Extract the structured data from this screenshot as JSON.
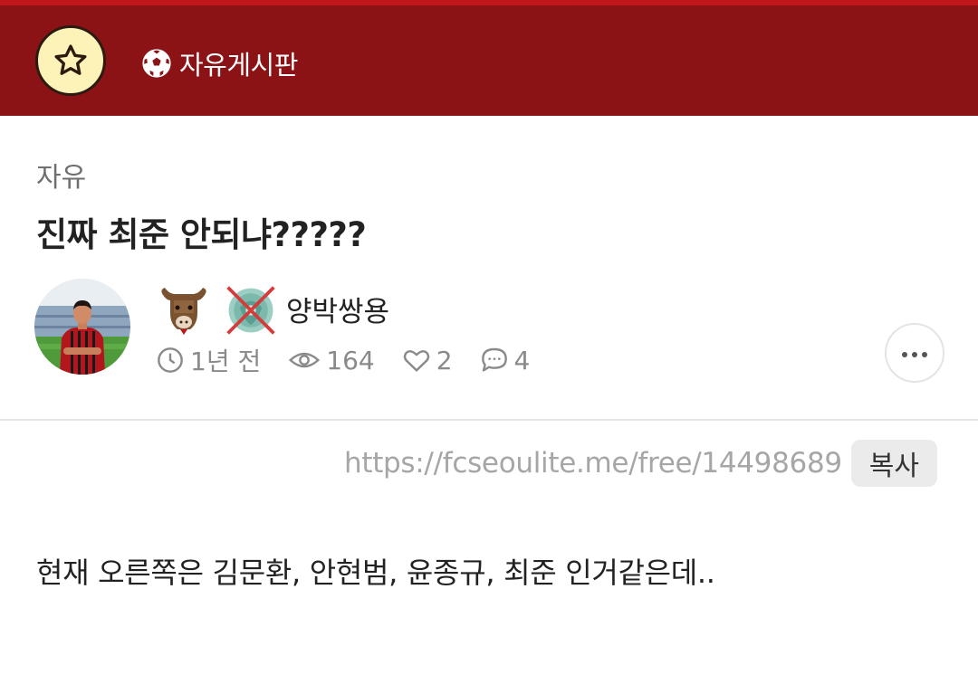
{
  "header": {
    "favorite_icon": "star-icon",
    "board_icon": "soccer-ball-icon",
    "board_title": "자유게시판",
    "colors": {
      "bar": "#8b1215",
      "bar_top_line": "#c0161c",
      "favorite_bg": "#fdf3b9"
    }
  },
  "post": {
    "category": "자유",
    "title": "진짜 최준 안되냐?????",
    "author": {
      "name": "양박쌍용",
      "avatar": "player-photo-avatar",
      "badges": [
        "bull-icon",
        "crossed-out-emblem-icon"
      ]
    },
    "meta": {
      "time_icon": "clock-icon",
      "time": "1년 전",
      "views_icon": "eye-icon",
      "views": "164",
      "likes_icon": "heart-icon",
      "likes": "2",
      "comments_icon": "comment-icon",
      "comments": "4"
    },
    "more_icon": "ellipsis-icon",
    "url": "https://fcseoulite.me/free/14498689",
    "copy_label": "복사",
    "body": "현재 오른쪽은 김문환, 안현범, 윤종규, 최준 인거같은데.."
  }
}
